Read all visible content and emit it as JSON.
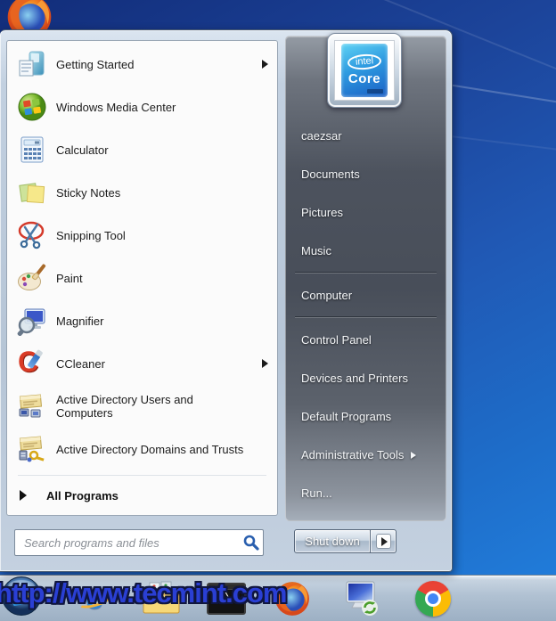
{
  "desktop": {
    "watermark_text": "http://www.tecmint.com"
  },
  "start_menu": {
    "left_panel": {
      "items": [
        {
          "label": "Getting Started",
          "icon": "getting-started-icon",
          "has_submenu": true
        },
        {
          "label": "Windows Media Center",
          "icon": "media-center-icon",
          "has_submenu": false
        },
        {
          "label": "Calculator",
          "icon": "calculator-icon",
          "has_submenu": false
        },
        {
          "label": "Sticky Notes",
          "icon": "sticky-notes-icon",
          "has_submenu": false
        },
        {
          "label": "Snipping Tool",
          "icon": "snipping-tool-icon",
          "has_submenu": false
        },
        {
          "label": "Paint",
          "icon": "paint-icon",
          "has_submenu": false
        },
        {
          "label": "Magnifier",
          "icon": "magnifier-icon",
          "has_submenu": false
        },
        {
          "label": "CCleaner",
          "icon": "ccleaner-icon",
          "has_submenu": true
        },
        {
          "label": "Active Directory Users and Computers",
          "icon": "ad-users-icon",
          "has_submenu": false
        },
        {
          "label": "Active Directory Domains and Trusts",
          "icon": "ad-domains-icon",
          "has_submenu": false
        }
      ],
      "all_programs": "All Programs",
      "search": {
        "placeholder": "Search programs and files",
        "value": ""
      }
    },
    "right_panel": {
      "user_name": "caezsar",
      "avatar": {
        "brand_line1": "intel",
        "brand_line2": "Core"
      },
      "items": [
        {
          "label": "Documents",
          "has_submenu": false
        },
        {
          "label": "Pictures",
          "has_submenu": false
        },
        {
          "label": "Music",
          "has_submenu": false
        },
        {
          "label": "Computer",
          "has_submenu": false
        },
        {
          "label": "Control Panel",
          "has_submenu": false
        },
        {
          "label": "Devices and Printers",
          "has_submenu": false
        },
        {
          "label": "Default Programs",
          "has_submenu": false
        },
        {
          "label": "Administrative Tools",
          "has_submenu": true
        },
        {
          "label": "Run...",
          "has_submenu": false
        }
      ],
      "shutdown": {
        "label": "Shut down"
      }
    }
  },
  "taskbar": {
    "icons": [
      "start-orb",
      "internet-explorer",
      "windows-explorer",
      "command-prompt",
      "firefox",
      "remote-desktop",
      "chrome"
    ]
  },
  "glyphs": {
    "ie": "e",
    "cmd": "C:\\_",
    "ccleaner": "C",
    "scissors": "✂"
  },
  "colors": {
    "desktop_blue_top": "#122d7a",
    "desktop_blue_bottom": "#2180de",
    "menu_glass": "#b6c5d6",
    "right_panel_dark": "#484e59",
    "left_panel_bg": "#fbfbfb",
    "watermark_blue": "#2a3fd4"
  }
}
